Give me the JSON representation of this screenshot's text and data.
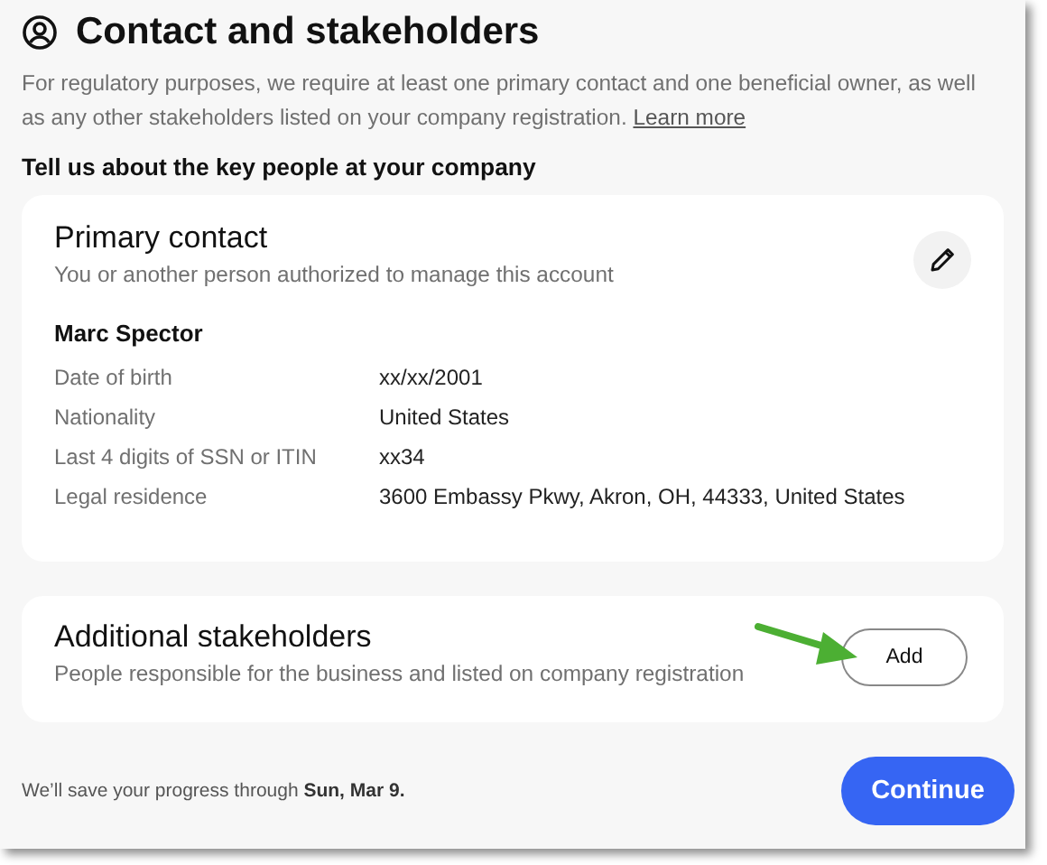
{
  "header": {
    "title": "Contact and stakeholders",
    "intro": "For regulatory purposes, we require at least one primary contact and one beneficial owner, as well as any other stakeholders listed on your company registration.",
    "link": "Learn more"
  },
  "section_heading": "Tell us about the key people at your company",
  "primary_contact": {
    "title": "Primary contact",
    "subtitle": "You or another person authorized to manage this account",
    "name": "Marc Spector",
    "fields": [
      {
        "label": "Date of birth",
        "value": "xx/xx/2001"
      },
      {
        "label": "Nationality",
        "value": "United States"
      },
      {
        "label": "Last 4 digits of SSN or ITIN",
        "value": "xx34"
      },
      {
        "label": "Legal residence",
        "value": "3600 Embassy Pkwy, Akron, OH, 44333, United States"
      }
    ]
  },
  "additional_stakeholders": {
    "title": "Additional stakeholders",
    "subtitle": "People responsible for the business and listed on company registration",
    "button": "Add"
  },
  "footer": {
    "note": "We’ll save your progress through **Sun, Mar 9.**",
    "button": "Continue"
  }
}
